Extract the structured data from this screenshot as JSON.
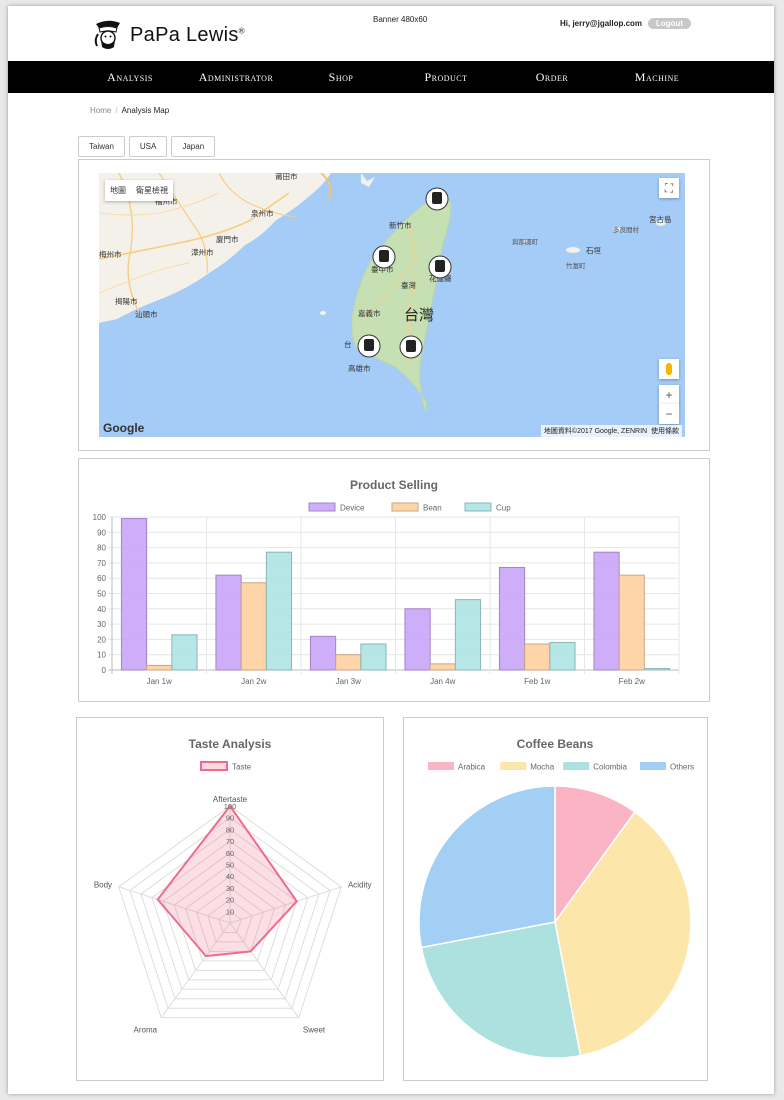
{
  "header": {
    "logo_text": "PaPa Lewis",
    "logo_mark": "®",
    "banner": "Banner 480x60",
    "user": "Hi, jerry@jgallop.com",
    "logout_label": "Logout"
  },
  "nav": {
    "items": [
      "Analysis",
      "Administrator",
      "Shop",
      "Product",
      "Order",
      "Machine"
    ]
  },
  "breadcrumb": {
    "home": "Home",
    "sep": "/",
    "current": "Analysis Map"
  },
  "tabs": [
    "Taiwan",
    "USA",
    "Japan"
  ],
  "map": {
    "map_type": "地圖",
    "satellite_type": "衛星檢視",
    "attribution": "地圖資料©2017 Google, ZENRIN",
    "terms": "使用條款",
    "google": "Google",
    "labels": {
      "putian": "莆田市",
      "fuzhou": "福州市",
      "quanzhou": "泉州市",
      "xiamen": "廈門市",
      "zhangzhou": "漳州市",
      "meizhou": "梅州市",
      "jieyang": "揭陽市",
      "shantou": "汕頭市",
      "hsinchu": "新竹市",
      "taichung": "臺中市",
      "hualien": "花蓮縣",
      "taiwan_small": "臺灣",
      "taiwan": "台灣",
      "chiayi": "嘉義市",
      "kaohsiung": "高雄市",
      "tainan": "台",
      "yonaguni": "與那國町",
      "ishigaki": "石垣",
      "taketomi": "竹富町",
      "tarama": "多良間村",
      "miyako": "宮古島"
    }
  },
  "product_chart": {
    "chart_data": {
      "type": "bar",
      "title": "Product Selling",
      "categories": [
        "Jan 1w",
        "Jan 2w",
        "Jan 3w",
        "Jan 4w",
        "Feb 1w",
        "Feb 2w"
      ],
      "series": [
        {
          "name": "Device",
          "values": [
            99,
            62,
            22,
            40,
            67,
            77
          ],
          "color": "#caa5f8"
        },
        {
          "name": "Bean",
          "values": [
            3,
            57,
            10,
            4,
            17,
            62
          ],
          "color": "#fdd0a0"
        },
        {
          "name": "Cup",
          "values": [
            23,
            77,
            17,
            46,
            18,
            1
          ],
          "color": "#aee3e3"
        }
      ],
      "ylim": [
        0,
        100
      ],
      "yticks": [
        "0",
        "10",
        "20",
        "30",
        "40",
        "50",
        "60",
        "70",
        "80",
        "90",
        "100"
      ],
      "legend": "top",
      "grid": true
    }
  },
  "taste_chart": {
    "chart_data": {
      "type": "radar",
      "title": "Taste Analysis",
      "axes": [
        "Aftertaste",
        "Acidity",
        "Sweet",
        "Aroma",
        "Body"
      ],
      "series": [
        {
          "name": "Taste",
          "values": [
            100,
            60,
            30,
            35,
            65
          ],
          "color": "#f06b8c"
        }
      ],
      "range": [
        0,
        100
      ],
      "ticks": [
        "10",
        "20",
        "30",
        "40",
        "50",
        "60",
        "70",
        "80",
        "90",
        "100"
      ],
      "legend": "top"
    }
  },
  "beans_chart": {
    "chart_data": {
      "type": "pie",
      "title": "Coffee Beans",
      "labels": [
        "Arabica",
        "Mocha",
        "Colombia",
        "Others"
      ],
      "values": [
        10,
        37,
        25,
        28
      ],
      "colors": [
        "#fbb4c4",
        "#fde6a9",
        "#ace1e0",
        "#a3cff4"
      ],
      "legend": "top"
    }
  }
}
